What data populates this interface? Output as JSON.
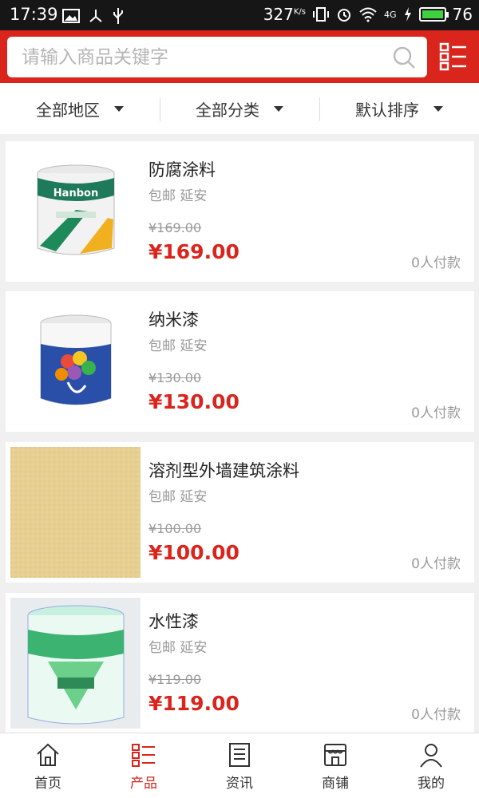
{
  "status_bar": {
    "time": "17:39",
    "speed": "327",
    "speed_unit": "K/s",
    "network": "4G",
    "battery": "76"
  },
  "search": {
    "placeholder": "请输入商品关键字"
  },
  "filters": [
    {
      "label": "全部地区"
    },
    {
      "label": "全部分类"
    },
    {
      "label": "默认排序"
    }
  ],
  "products": [
    {
      "name": "防腐涂料",
      "meta": "包邮 延安",
      "old_price": "¥169.00",
      "price": "¥169.00",
      "sold": "0人付款",
      "brand_text": "Hanbon"
    },
    {
      "name": "纳米漆",
      "meta": "包邮 延安",
      "old_price": "¥130.00",
      "price": "¥130.00",
      "sold": "0人付款",
      "brand_text": ""
    },
    {
      "name": "溶剂型外墙建筑涂料",
      "meta": "包邮 延安",
      "old_price": "¥100.00",
      "price": "¥100.00",
      "sold": "0人付款",
      "brand_text": ""
    },
    {
      "name": "水性漆",
      "meta": "包邮 延安",
      "old_price": "¥119.00",
      "price": "¥119.00",
      "sold": "0人付款",
      "brand_text": ""
    }
  ],
  "tabs": [
    {
      "label": "首页",
      "icon": "home-icon"
    },
    {
      "label": "产品",
      "icon": "list-icon"
    },
    {
      "label": "资讯",
      "icon": "news-icon"
    },
    {
      "label": "商铺",
      "icon": "shop-icon"
    },
    {
      "label": "我的",
      "icon": "user-icon"
    }
  ],
  "colors": {
    "accent": "#d9251c",
    "muted": "#999999"
  }
}
